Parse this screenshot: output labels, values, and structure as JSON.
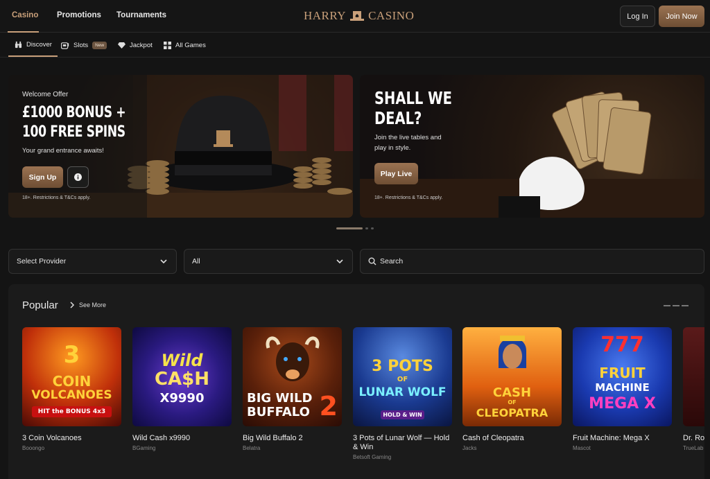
{
  "topnav": {
    "links": [
      {
        "label": "Casino",
        "active": true
      },
      {
        "label": "Promotions"
      },
      {
        "label": "Tournaments"
      }
    ],
    "logo_left": "HARRY",
    "logo_right": "CASINO",
    "login_label": "Log In",
    "join_label": "Join Now"
  },
  "subnav": {
    "items": [
      {
        "label": "Discover",
        "icon": "binoculars-icon",
        "active": true
      },
      {
        "label": "Slots",
        "icon": "slot-machine-icon",
        "badge": "New"
      },
      {
        "label": "Jackpot",
        "icon": "diamond-icon"
      },
      {
        "label": "All Games",
        "icon": "grid-icon"
      }
    ]
  },
  "banners": {
    "left": {
      "eyebrow": "Welcome Offer",
      "headline_line1": "£1000 BONUS +",
      "headline_line2": "100 FREE SPINS",
      "subtitle": "Your grand entrance awaits!",
      "button": "Sign Up",
      "terms": "18+. Restrictions & T&Cs apply."
    },
    "right": {
      "headline_line1": "SHALL WE",
      "headline_line2": "DEAL?",
      "subtitle": "Join the live tables and play in style.",
      "button": "Play Live",
      "terms": "18+. Restrictions & T&Cs apply."
    }
  },
  "filters": {
    "provider": "Select Provider",
    "category": "All",
    "search_placeholder": "Search"
  },
  "popular": {
    "title": "Popular",
    "see_more": "See More",
    "games": [
      {
        "name": "3 Coin Volcanoes",
        "provider": "Booongo",
        "art_line1": "3",
        "art_line2": "COIN",
        "art_line3": "VOLCANOES",
        "art_line4": "HIT the BONUS 4x3"
      },
      {
        "name": "Wild Cash x9990",
        "provider": "BGaming",
        "art_line1": "Wild",
        "art_line2": "CA$H",
        "art_line3": "X9990"
      },
      {
        "name": "Big Wild Buffalo 2",
        "provider": "Belatra",
        "art_line1": "BIG WILD",
        "art_line2": "BUFFALO",
        "art_line3": "2"
      },
      {
        "name": "3 Pots of Lunar Wolf — Hold & Win",
        "provider": "Betsoft Gaming",
        "art_line1": "3 POTS",
        "art_line2": "OF",
        "art_line3": "LUNAR WOLF",
        "art_line4": "HOLD & WIN"
      },
      {
        "name": "Cash of Cleopatra",
        "provider": "Jacks",
        "art_line1": "CASH",
        "art_line2": "OF",
        "art_line3": "CLEOPATRA"
      },
      {
        "name": "Fruit Machine: Mega X",
        "provider": "Mascot",
        "art_line1": "777",
        "art_line2": "FRUIT",
        "art_line3": "MACHINE",
        "art_line4": "MEGA X"
      },
      {
        "name": "Dr. Ro... React...",
        "provider": "TrueLab"
      }
    ]
  },
  "colors": {
    "accent": "#c9a07a",
    "button_gold": "#8a6445",
    "background": "#141414"
  }
}
